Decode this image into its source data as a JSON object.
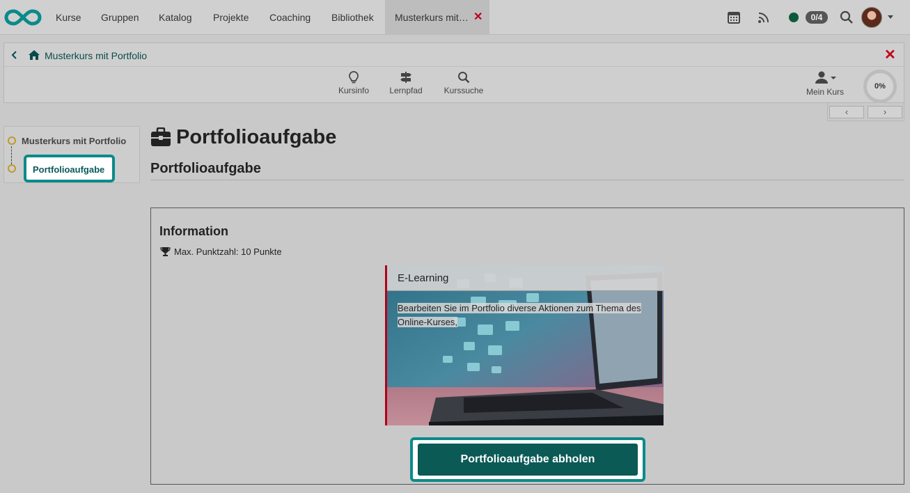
{
  "topnav": {
    "items": [
      "Kurse",
      "Gruppen",
      "Katalog",
      "Projekte",
      "Coaching",
      "Bibliothek"
    ],
    "active_tab": "Musterkurs mit…",
    "badge": "0/4",
    "icons": [
      "calendar-icon",
      "rss-icon",
      "search-icon"
    ]
  },
  "coursebar": {
    "breadcrumb": "Musterkurs mit Portfolio",
    "tools": [
      "Kursinfo",
      "Lernpfad",
      "Kurssuche"
    ],
    "my_course": "Mein Kurs",
    "progress": "0%"
  },
  "leftmenu": {
    "root": "Musterkurs mit Portfolio",
    "active": "Portfolioaufgabe"
  },
  "main": {
    "title": "Portfolioaufgabe",
    "subtitle": "Portfolioaufgabe",
    "info": {
      "heading": "Information",
      "points": "Max. Punktzahl: 10 Punkte"
    },
    "card": {
      "title": "E-Learning",
      "text": "Bearbeiten Sie im Portfolio diverse Aktionen zum Thema des Online-Kurses,"
    },
    "cta": "Portfolioaufgabe abholen"
  },
  "colors": {
    "accent": "#0a8a8a",
    "cta": "#0b5a56",
    "close": "#c0001b"
  }
}
